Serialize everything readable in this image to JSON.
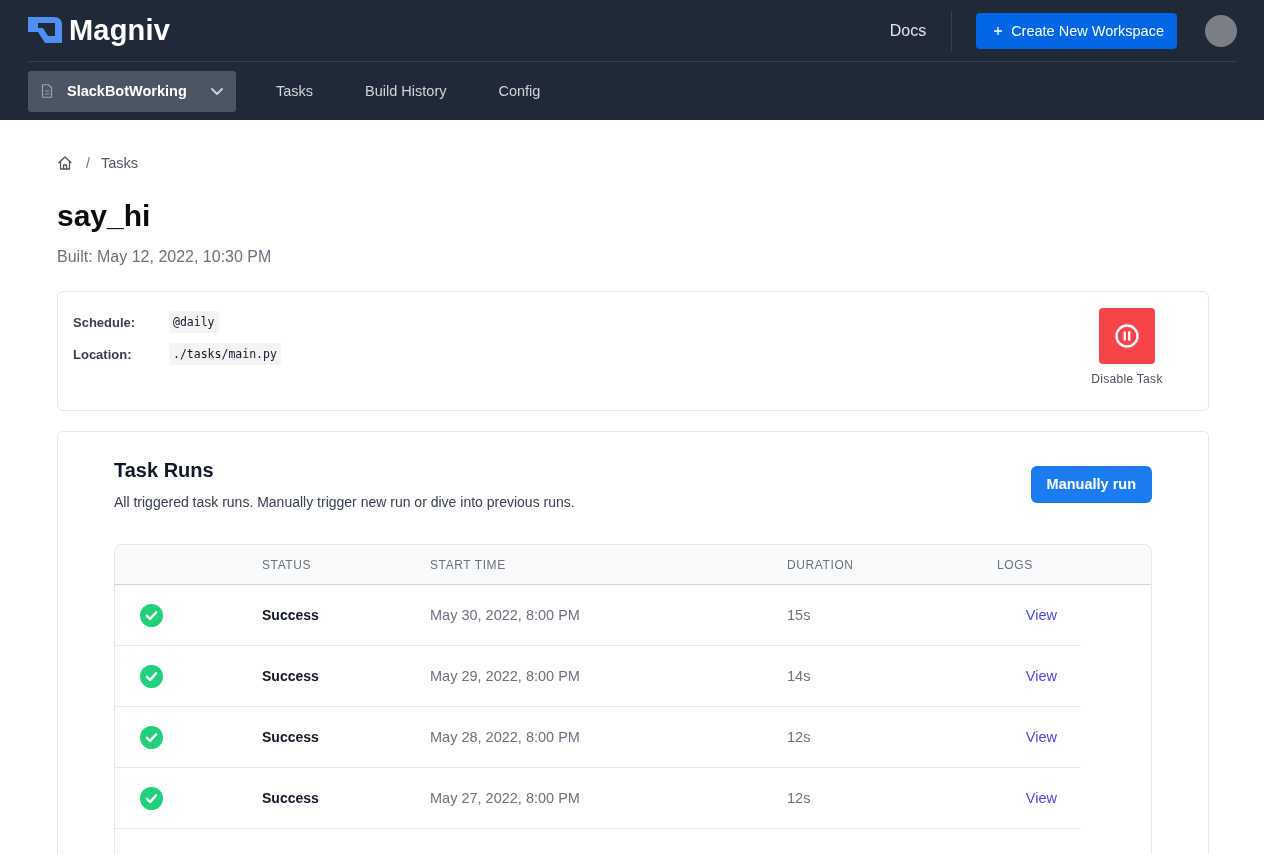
{
  "header": {
    "brand": "Magniv",
    "docs_link": "Docs",
    "create_button": "Create New Workspace"
  },
  "nav": {
    "workspace": "SlackBotWorking",
    "tabs": [
      "Tasks",
      "Build History",
      "Config"
    ]
  },
  "breadcrumb": {
    "separator": "/",
    "current": "Tasks"
  },
  "task": {
    "name": "say_hi",
    "built": "Built: May 12, 2022, 10:30 PM",
    "details": [
      {
        "label": "Schedule:",
        "value": "@daily"
      },
      {
        "label": "Location:",
        "value": "./tasks/main.py"
      }
    ],
    "disable_button": "Disable Task"
  },
  "runs": {
    "title": "Task Runs",
    "description": "All triggered task runs. Manually trigger new run or dive into previous runs.",
    "button": "Manually run",
    "columns": [
      "STATUS",
      "START TIME",
      "DURATION",
      "LOGS"
    ],
    "rows": [
      {
        "kind": "success",
        "status": "Success",
        "start_time": "May 30, 2022, 8:00 PM",
        "duration": "15s",
        "logs": "View"
      },
      {
        "kind": "success",
        "status": "Success",
        "start_time": "May 29, 2022, 8:00 PM",
        "duration": "14s",
        "logs": "View"
      },
      {
        "kind": "success",
        "status": "Success",
        "start_time": "May 28, 2022, 8:00 PM",
        "duration": "12s",
        "logs": "View"
      },
      {
        "kind": "success",
        "status": "Success",
        "start_time": "May 27, 2022, 8:00 PM",
        "duration": "12s",
        "logs": "View"
      }
    ]
  }
}
